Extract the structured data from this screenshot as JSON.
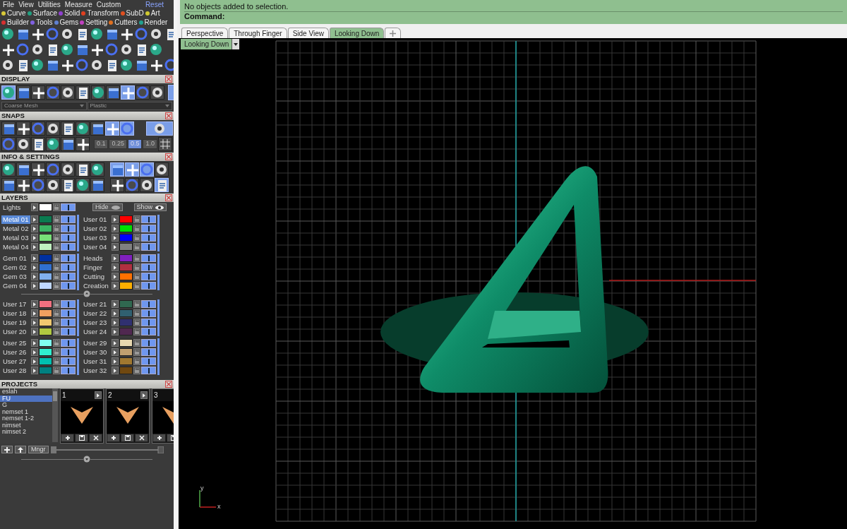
{
  "menu": {
    "items": [
      "File",
      "View",
      "Utilities",
      "Measure",
      "Custom"
    ],
    "reset": "Reset"
  },
  "categories": [
    {
      "label": "Curve",
      "color": "#d8c838"
    },
    {
      "label": "Surface",
      "color": "#20a080"
    },
    {
      "label": "Solid",
      "color": "#9040d0"
    },
    {
      "label": "Transform",
      "color": "#e04020"
    },
    {
      "label": "SubD",
      "color": "#e05020"
    },
    {
      "label": "Art",
      "color": "#d0c830"
    },
    {
      "label": "Builder",
      "color": "#d83030"
    },
    {
      "label": "Tools",
      "color": "#8060e0"
    },
    {
      "label": "Gems",
      "color": "#6080d0"
    },
    {
      "label": "Setting",
      "color": "#c040c0"
    },
    {
      "label": "Cutters",
      "color": "#e07020"
    },
    {
      "label": "Render",
      "color": "#20a090"
    }
  ],
  "display": {
    "title": "DISPLAY",
    "buttons": [
      {
        "selected": true
      },
      {
        "selected": false
      },
      {
        "selected": false
      },
      {
        "selected": false
      },
      {
        "selected": false
      },
      {
        "selected": false
      },
      {
        "selected": false
      },
      {
        "selected": false
      },
      {
        "selected": true
      },
      {
        "selected": false
      },
      {
        "selected": false
      }
    ],
    "mesh": "Coarse Mesh",
    "material": "Plastic"
  },
  "snaps": {
    "title": "SNAPS",
    "buttons": [
      {
        "selected": false
      },
      {
        "selected": false
      },
      {
        "selected": false
      },
      {
        "selected": false
      },
      {
        "selected": false
      },
      {
        "selected": false
      },
      {
        "selected": false
      },
      {
        "selected": true
      },
      {
        "selected": true
      },
      {
        "selected": true
      }
    ],
    "increments": [
      {
        "label": "0.1",
        "selected": false
      },
      {
        "label": "0.25",
        "selected": false
      },
      {
        "label": "0.5",
        "selected": true
      },
      {
        "label": "1.0",
        "selected": false
      }
    ]
  },
  "info": {
    "title": "INFO & SETTINGS",
    "rows": [
      [
        {
          "selected": false
        },
        {
          "selected": false
        },
        {
          "selected": false
        },
        {
          "selected": false
        },
        {
          "selected": false
        },
        {
          "selected": false
        },
        {
          "selected": false
        },
        {
          "selected": true
        },
        {
          "selected": true
        },
        {
          "selected": true
        },
        {
          "selected": false
        }
      ],
      [
        {
          "selected": false
        },
        {
          "selected": false
        },
        {
          "selected": false
        },
        {
          "selected": false
        },
        {
          "selected": false
        },
        {
          "selected": false
        },
        {
          "selected": false
        },
        {
          "selected": false
        },
        {
          "selected": false
        },
        {
          "selected": false
        },
        {
          "selected": true
        }
      ]
    ]
  },
  "layers": {
    "title": "LAYERS",
    "lights": {
      "name": "Lights",
      "color": "#ffffff",
      "on": true
    },
    "hide": "Hide",
    "show": "Show",
    "sections": [
      {
        "blocks": [
          {
            "left": [
              {
                "name": "Metal 01",
                "color": "#0a7a50",
                "selected": true,
                "on": true
              },
              {
                "name": "Metal 02",
                "color": "#3cb464",
                "selected": false,
                "on": true
              },
              {
                "name": "Metal 03",
                "color": "#78e078",
                "selected": false,
                "on": true
              },
              {
                "name": "Metal 04",
                "color": "#c0f0c0",
                "selected": false,
                "on": true
              }
            ],
            "right": [
              {
                "name": "User 01",
                "color": "#ff0000",
                "selected": false,
                "on": true
              },
              {
                "name": "User 02",
                "color": "#00e000",
                "selected": false,
                "on": true
              },
              {
                "name": "User 03",
                "color": "#0000ff",
                "selected": false,
                "on": true
              },
              {
                "name": "User 04",
                "color": "#808080",
                "selected": false,
                "on": true
              }
            ]
          },
          {
            "left": [
              {
                "name": "Gem 01",
                "color": "#0030a0",
                "selected": false,
                "on": true
              },
              {
                "name": "Gem 02",
                "color": "#3070d0",
                "selected": false,
                "on": true
              },
              {
                "name": "Gem 03",
                "color": "#80b0f0",
                "selected": false,
                "on": true
              },
              {
                "name": "Gem 04",
                "color": "#c0d8ff",
                "selected": false,
                "on": true
              }
            ],
            "right": [
              {
                "name": "Heads",
                "color": "#8020c0",
                "selected": false,
                "on": true
              },
              {
                "name": "Finger",
                "color": "#b03040",
                "selected": false,
                "on": true
              },
              {
                "name": "Cutting",
                "color": "#ff7000",
                "selected": false,
                "on": true
              },
              {
                "name": "Creation",
                "color": "#ffb000",
                "selected": false,
                "on": true
              }
            ]
          }
        ]
      },
      {
        "blocks": [
          {
            "left": [
              {
                "name": "User 17",
                "color": "#f07080",
                "selected": false,
                "on": true
              },
              {
                "name": "User 18",
                "color": "#f0a060",
                "selected": false,
                "on": true
              },
              {
                "name": "User 19",
                "color": "#f0c870",
                "selected": false,
                "on": true
              },
              {
                "name": "User 20",
                "color": "#b0c840",
                "selected": false,
                "on": true
              }
            ],
            "right": [
              {
                "name": "User 21",
                "color": "#306850",
                "selected": false,
                "on": true
              },
              {
                "name": "User 22",
                "color": "#306070",
                "selected": false,
                "on": true
              },
              {
                "name": "User 23",
                "color": "#303070",
                "selected": false,
                "on": true
              },
              {
                "name": "User 24",
                "color": "#502850",
                "selected": false,
                "on": true
              }
            ]
          },
          {
            "left": [
              {
                "name": "User 25",
                "color": "#80fff0",
                "selected": false,
                "on": true
              },
              {
                "name": "User 26",
                "color": "#30f0d0",
                "selected": false,
                "on": true
              },
              {
                "name": "User 27",
                "color": "#00c0b0",
                "selected": false,
                "on": true
              },
              {
                "name": "User 28",
                "color": "#008080",
                "selected": false,
                "on": true
              }
            ],
            "right": [
              {
                "name": "User 29",
                "color": "#e8d8b0",
                "selected": false,
                "on": true
              },
              {
                "name": "User 30",
                "color": "#c0a070",
                "selected": false,
                "on": true
              },
              {
                "name": "User 31",
                "color": "#a07830",
                "selected": false,
                "on": true
              },
              {
                "name": "User 32",
                "color": "#704810",
                "selected": false,
                "on": true
              }
            ]
          }
        ]
      }
    ]
  },
  "projects": {
    "title": "PROJECTS",
    "list": [
      {
        "name": "eslah",
        "selected": false
      },
      {
        "name": "FU",
        "selected": true
      },
      {
        "name": "G",
        "selected": false
      },
      {
        "name": "nemset 1",
        "selected": false
      },
      {
        "name": "nemset 1-2",
        "selected": false
      },
      {
        "name": "nimset",
        "selected": false
      },
      {
        "name": "nimset 2",
        "selected": false
      }
    ],
    "thumbnails": [
      {
        "number": "1"
      },
      {
        "number": "2"
      },
      {
        "number": "3"
      }
    ],
    "manager": "Mngr"
  },
  "command": {
    "lines": [
      "No objects added to selection."
    ],
    "prompt": "Command:"
  },
  "tabs": [
    {
      "label": "Perspective",
      "selected": false
    },
    {
      "label": "Through Finger",
      "selected": false
    },
    {
      "label": "Side View",
      "selected": false
    },
    {
      "label": "Looking Down",
      "selected": true
    }
  ],
  "viewport": {
    "label": "Looking Down",
    "axes": {
      "x": "x",
      "y": "y"
    }
  }
}
